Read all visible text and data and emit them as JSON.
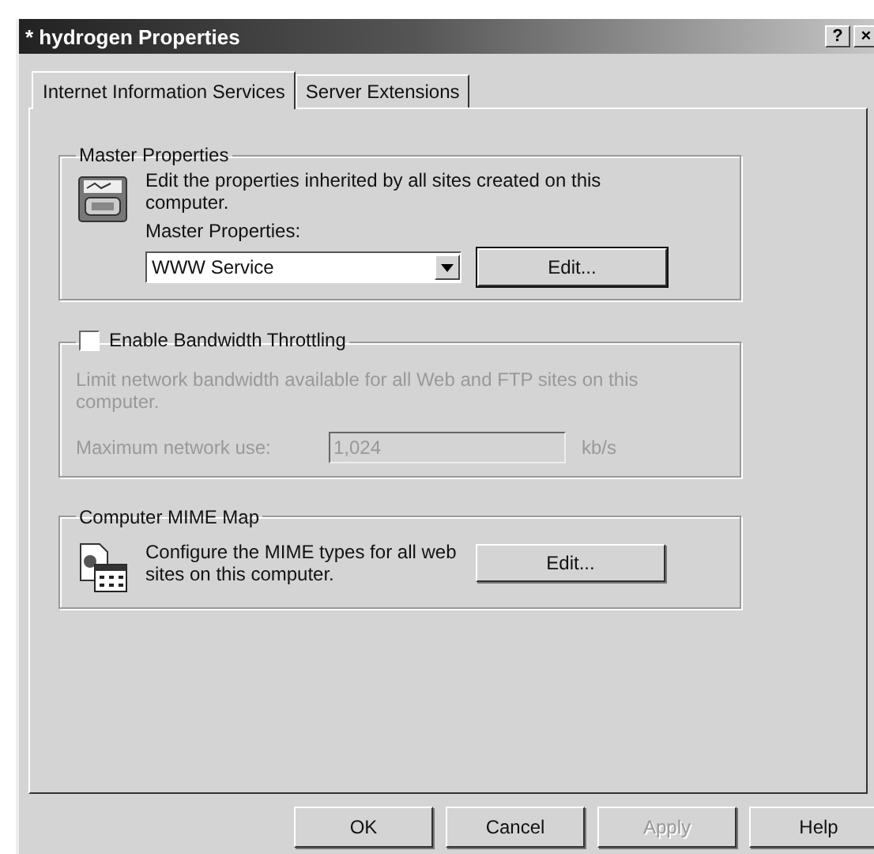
{
  "window": {
    "title": "* hydrogen Properties",
    "help_button": "?",
    "close_button": "×"
  },
  "tabs": [
    {
      "label": "Internet Information Services",
      "selected": true
    },
    {
      "label": "Server Extensions",
      "selected": false
    }
  ],
  "master_properties": {
    "title": "Master Properties",
    "description": "Edit the properties inherited by all sites created on this computer.",
    "dropdown_label": "Master Properties:",
    "dropdown_value": "WWW Service",
    "edit_button": "Edit..."
  },
  "bandwidth_throttling": {
    "label": "Enable Bandwidth Throttling",
    "checked": false,
    "description": "Limit network bandwidth available for all Web and FTP sites on this computer.",
    "field_label": "Maximum network use:",
    "value": "1,024",
    "unit": "kb/s"
  },
  "mime_map": {
    "title": "Computer MIME Map",
    "description": "Configure the MIME types for all web sites on this computer.",
    "edit_button": "Edit..."
  },
  "buttons": [
    {
      "label": "OK",
      "disabled": false
    },
    {
      "label": "Cancel",
      "disabled": false
    },
    {
      "label": "Apply",
      "disabled": true
    },
    {
      "label": "Help",
      "disabled": false
    }
  ]
}
